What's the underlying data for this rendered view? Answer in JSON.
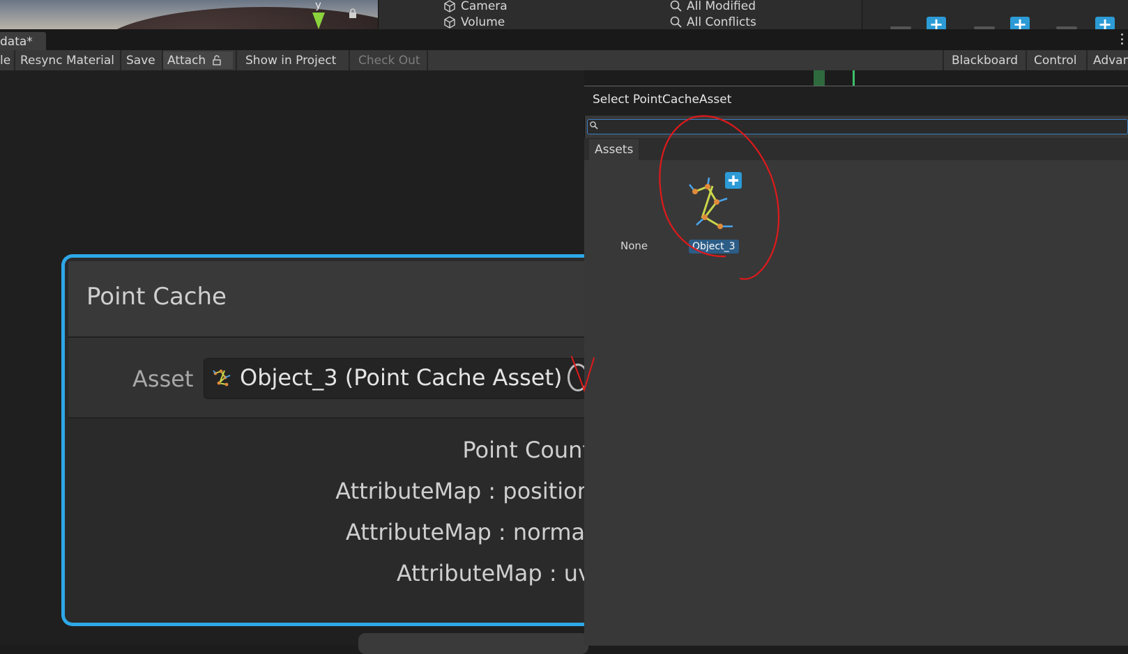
{
  "scene": {
    "gizmo_axis": "y"
  },
  "hierarchy": {
    "items": [
      "Camera",
      "Volume"
    ]
  },
  "search_filters": {
    "items": [
      "All Modified",
      "All Conflicts"
    ]
  },
  "document_tab": {
    "label": "data*"
  },
  "toolbar": {
    "partial_left": "le",
    "resync_material": "Resync Material",
    "save": "Save",
    "attach": "Attach",
    "show_in_project": "Show in Project",
    "check_out": "Check Out",
    "blackboard": "Blackboard",
    "control": "Control",
    "advanced": "Advan"
  },
  "node": {
    "title": "Point Cache",
    "asset_label": "Asset",
    "asset_value": "Object_3 (Point Cache Asset)",
    "info_lines": [
      "Point Count",
      "AttributeMap : position",
      "AttributeMap : normal",
      "AttributeMap : uv"
    ]
  },
  "picker": {
    "title": "Select PointCacheAsset",
    "search_value": "",
    "tab": "Assets",
    "items": [
      {
        "label": "None",
        "selected": false
      },
      {
        "label": "Object_3",
        "selected": true,
        "icon": "point-cache-asset-icon"
      }
    ]
  },
  "colors": {
    "accent_blue": "#2ea8e8",
    "selection_blue": "#2c5d87",
    "annotation_red": "#e0191b",
    "plus_blue": "#2c9bd6"
  }
}
